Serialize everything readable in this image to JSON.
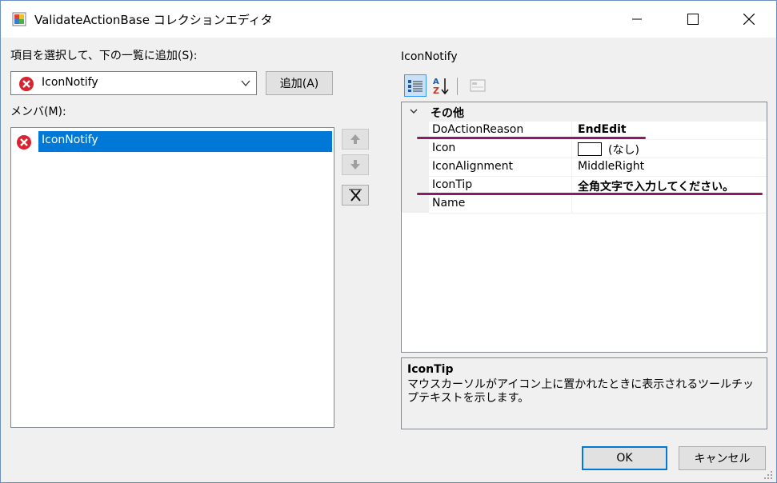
{
  "window": {
    "title": "ValidateActionBase コレクションエディタ"
  },
  "left": {
    "select_label": "項目を選択して、下の一覧に追加(S):",
    "combo_value": "IconNotify",
    "add_button": "追加(A)",
    "members_label": "メンバ(M):",
    "members": [
      {
        "label": "IconNotify",
        "icon": "error-icon",
        "selected": true
      }
    ]
  },
  "side_buttons": {
    "up": "up-arrow-icon",
    "down": "down-arrow-icon",
    "delete": "delete-x-icon"
  },
  "right": {
    "object_name": "IconNotify",
    "category": "その他",
    "properties": [
      {
        "name": "DoActionReason",
        "value": "EndEdit",
        "bold": true
      },
      {
        "name": "Icon",
        "value": "(なし)",
        "bold": false
      },
      {
        "name": "IconAlignment",
        "value": "MiddleRight",
        "bold": false
      },
      {
        "name": "IconTip",
        "value": "全角文字で入力してください。",
        "bold": true
      },
      {
        "name": "Name",
        "value": "",
        "bold": false
      }
    ],
    "description_title": "IconTip",
    "description_text": "マウスカーソルがアイコン上に置かれたときに表示されるツールチップテキストを示します。"
  },
  "footer": {
    "ok": "OK",
    "cancel": "キャンセル"
  },
  "colors": {
    "selection": "#0078d7",
    "highlight_underline": "#8b1a6b",
    "error_red": "#d9232e"
  }
}
